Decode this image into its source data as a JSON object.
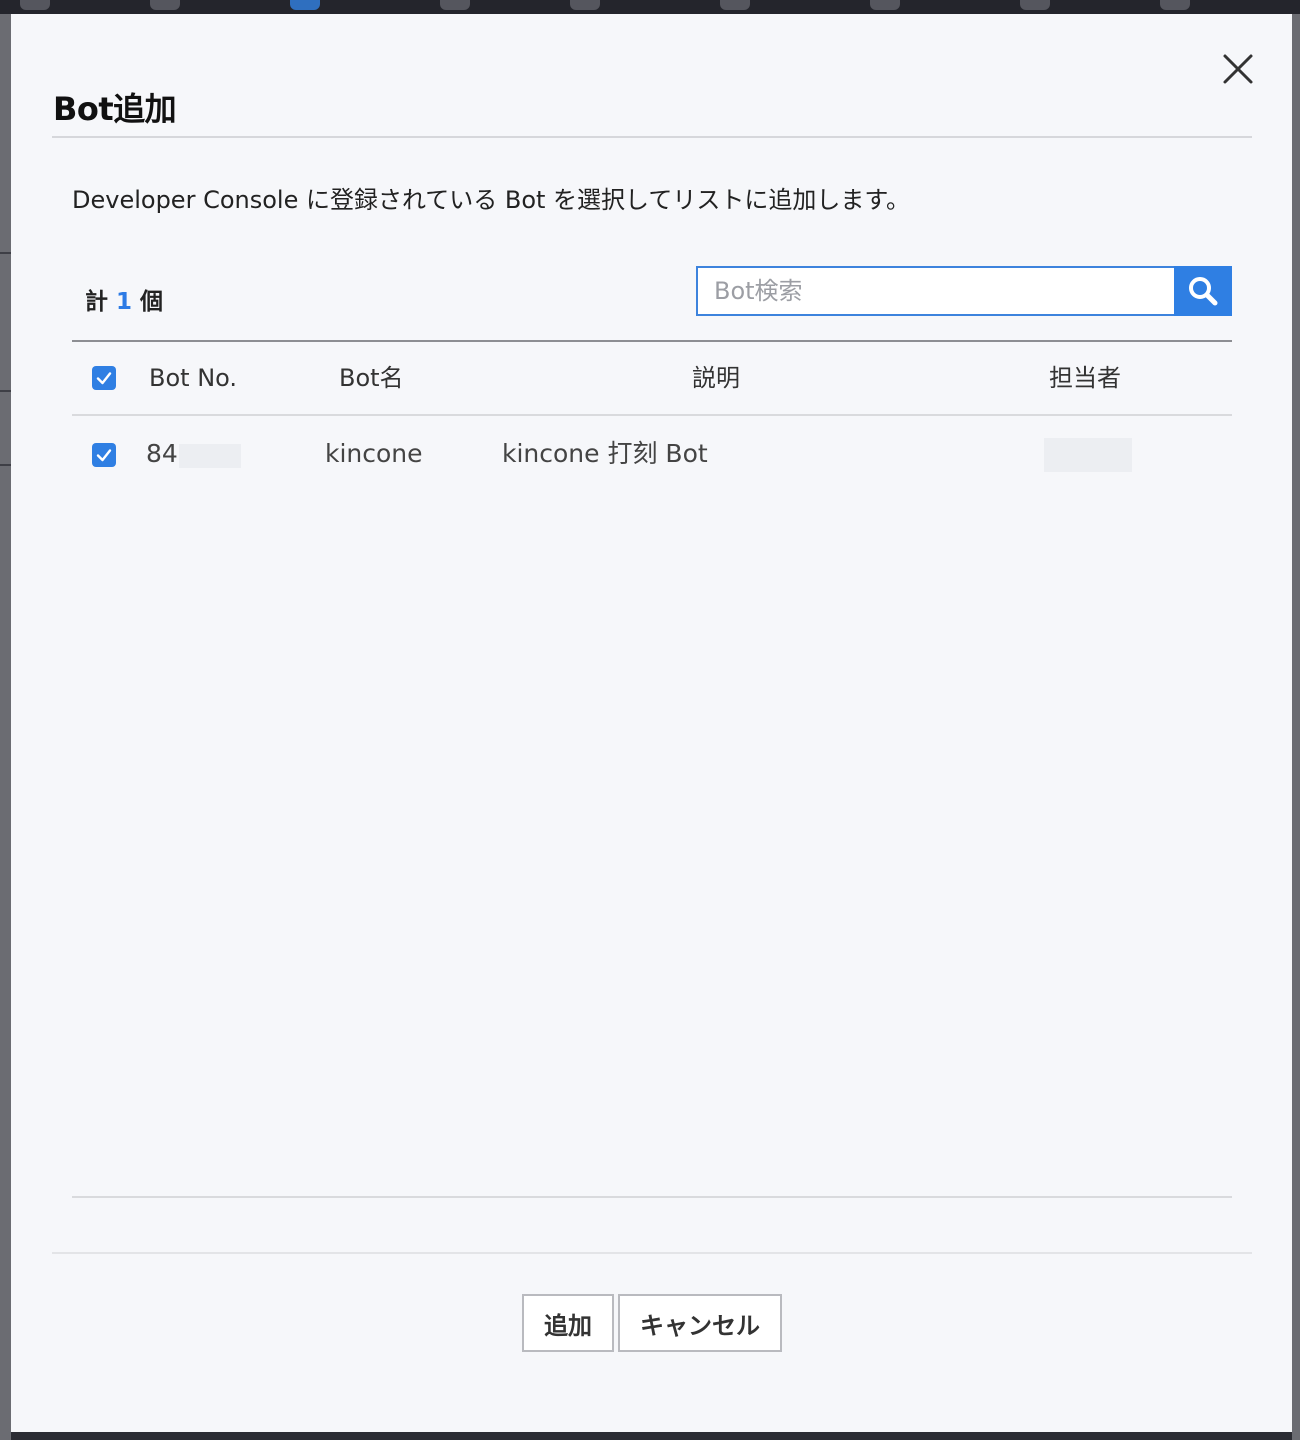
{
  "dialog": {
    "title": "Bot追加",
    "description": "Developer Console に登録されている Bot を選択してリストに追加します。",
    "count_prefix": "計",
    "count_value": "1",
    "count_suffix": "個",
    "search_placeholder": "Bot検索",
    "search_value": ""
  },
  "table": {
    "headers": {
      "bot_no": "Bot No.",
      "bot_name": "Bot名",
      "description": "説明",
      "owner": "担当者"
    },
    "select_all_checked": true,
    "rows": [
      {
        "checked": true,
        "bot_no": "84",
        "bot_name": "kincone",
        "description": "kincone 打刻 Bot",
        "owner": ""
      }
    ]
  },
  "footer": {
    "add_label": "追加",
    "cancel_label": "キャンセル"
  },
  "icons": {
    "close": "close-icon",
    "search": "search-icon",
    "check": "check-icon"
  },
  "colors": {
    "accent": "#2f7fe3",
    "modal_bg": "#f6f7fa"
  }
}
